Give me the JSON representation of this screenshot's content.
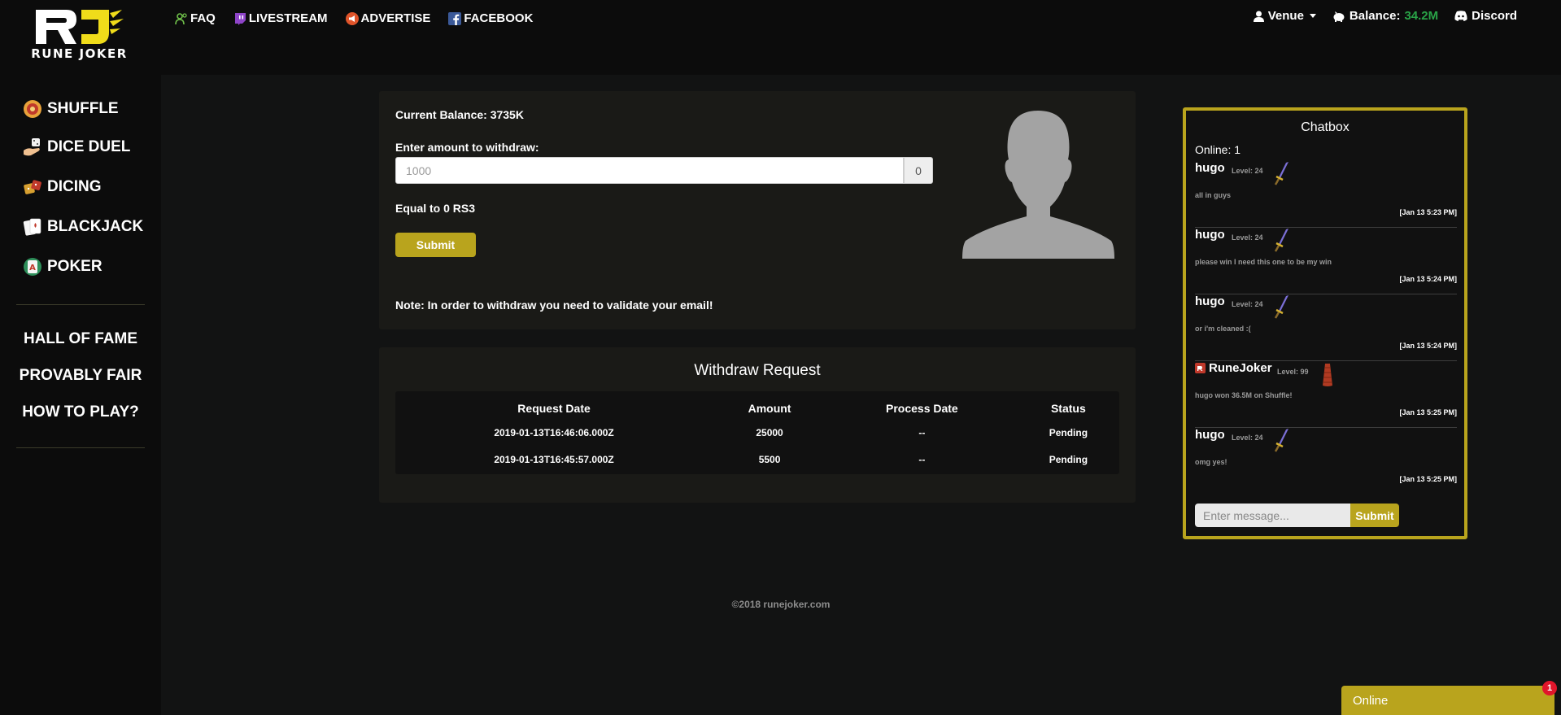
{
  "brand": {
    "logo_text": "RUNE JOKER",
    "accent_color": "#b9a41d",
    "balance_color": "#29a347"
  },
  "topnav": [
    {
      "label": "FAQ",
      "icon": "users-icon"
    },
    {
      "label": "LIVESTREAM",
      "icon": "twitch-icon"
    },
    {
      "label": "ADVERTISE",
      "icon": "megaphone-icon"
    },
    {
      "label": "FACEBOOK",
      "icon": "facebook-icon"
    }
  ],
  "topright": {
    "user_label": "Venue",
    "balance_label": "Balance:",
    "balance_value": "34.2M",
    "discord_label": "Discord"
  },
  "sidebar": {
    "games": [
      {
        "label": "SHUFFLE",
        "icon": "wheel-icon"
      },
      {
        "label": "DICE DUEL",
        "icon": "dice-hand-icon"
      },
      {
        "label": "DICING",
        "icon": "dice-icon"
      },
      {
        "label": "BLACKJACK",
        "icon": "cards-icon"
      },
      {
        "label": "POKER",
        "icon": "poker-card-icon"
      }
    ],
    "links": [
      "HALL OF FAME",
      "PROVABLY FAIR",
      "HOW TO PLAY?"
    ]
  },
  "withdraw": {
    "current_balance": "Current Balance: 3735K",
    "amount_label": "Enter amount to withdraw:",
    "amount_placeholder": "1000",
    "amount_addon": "0",
    "equal_text": "Equal to 0 RS3",
    "submit_label": "Submit",
    "note": "Note: In order to withdraw you need to validate your email!"
  },
  "requests": {
    "title": "Withdraw Request",
    "columns": [
      "Request Date",
      "Amount",
      "Process Date",
      "Status"
    ],
    "rows": [
      [
        "2019-01-13T16:46:06.000Z",
        "25000",
        "--",
        "Pending"
      ],
      [
        "2019-01-13T16:45:57.000Z",
        "5500",
        "--",
        "Pending"
      ]
    ]
  },
  "footer": "©2018 runejoker.com",
  "chatbox": {
    "title": "Chatbox",
    "online": "Online: 1",
    "messages": [
      {
        "user": "hugo",
        "level": "Level: 24",
        "text": "all in guys",
        "time": "[Jan 13 5:23 PM]"
      },
      {
        "user": "hugo",
        "level": "Level: 24",
        "text": "please win I need this one to be my win",
        "time": "[Jan 13 5:24 PM]"
      },
      {
        "user": "hugo",
        "level": "Level: 24",
        "text": "or i'm cleaned :(",
        "time": "[Jan 13 5:24 PM]"
      },
      {
        "user": "RuneJoker",
        "level": "Level: 99",
        "text": "hugo won 36.5M on Shuffle!",
        "time": "[Jan 13 5:25 PM]"
      },
      {
        "user": "hugo",
        "level": "Level: 24",
        "text": "omg yes!",
        "time": "[Jan 13 5:25 PM]"
      }
    ],
    "input_placeholder": "Enter message...",
    "submit_label": "Submit"
  },
  "online_widget": {
    "label": "Online",
    "badge": "1"
  }
}
